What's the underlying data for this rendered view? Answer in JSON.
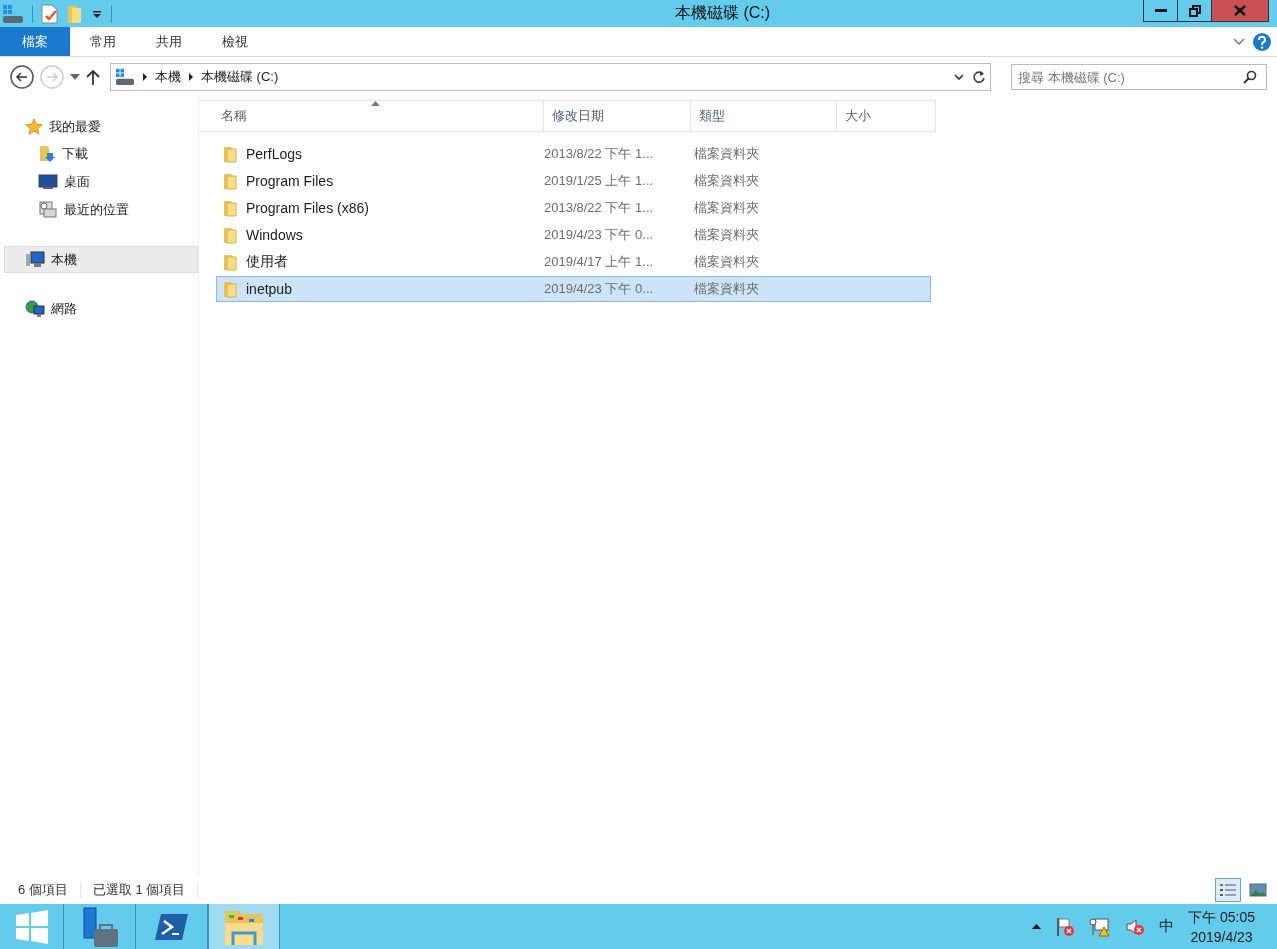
{
  "window": {
    "title": "本機磁碟 (C:)"
  },
  "ribbon": {
    "tabs": [
      {
        "label": "檔案",
        "kind": "file",
        "selected": false
      },
      {
        "label": "常用",
        "kind": "tab",
        "selected": false
      },
      {
        "label": "共用",
        "kind": "tab",
        "selected": false
      },
      {
        "label": "檢視",
        "kind": "tab",
        "selected": false
      }
    ]
  },
  "address": {
    "crumbs": [
      "本機",
      "本機磁碟 (C:)"
    ]
  },
  "search": {
    "placeholder": "搜尋 本機磁碟 (C:)"
  },
  "sidebar": {
    "items": [
      {
        "label": "我的最愛",
        "kind": "star",
        "selected": false,
        "children": [
          {
            "label": "下載",
            "kind": "download",
            "selected": false
          },
          {
            "label": "桌面",
            "kind": "desktop",
            "selected": false
          },
          {
            "label": "最近的位置",
            "kind": "recent",
            "selected": false
          }
        ]
      },
      {
        "label": "本機",
        "kind": "computer",
        "selected": true
      },
      {
        "label": "網路",
        "kind": "network",
        "selected": false
      }
    ]
  },
  "table": {
    "columns": [
      {
        "label": "名稱",
        "sorted": true
      },
      {
        "label": "修改日期",
        "sorted": false
      },
      {
        "label": "類型",
        "sorted": false
      },
      {
        "label": "大小",
        "sorted": false
      }
    ],
    "rows": [
      {
        "name": "PerfLogs",
        "modified": "2013/8/22 下午 1...",
        "type": "檔案資料夾",
        "selected": false
      },
      {
        "name": "Program Files",
        "modified": "2019/1/25 上午 1...",
        "type": "檔案資料夾",
        "selected": false
      },
      {
        "name": "Program Files (x86)",
        "modified": "2013/8/22 下午 1...",
        "type": "檔案資料夾",
        "selected": false
      },
      {
        "name": "Windows",
        "modified": "2019/4/23 下午 0...",
        "type": "檔案資料夾",
        "selected": false
      },
      {
        "name": "使用者",
        "modified": "2019/4/17 上午 1...",
        "type": "檔案資料夾",
        "selected": false
      },
      {
        "name": "inetpub",
        "modified": "2019/4/23 下午 0...",
        "type": "檔案資料夾",
        "selected": true
      }
    ]
  },
  "status_bar": {
    "item_count": "6 個項目",
    "selection": "已選取 1 個項目",
    "view_buttons": [
      {
        "kind": "details",
        "selected": true
      },
      {
        "kind": "large-icons",
        "selected": false
      }
    ]
  },
  "taskbar": {
    "apps": [
      {
        "kind": "start",
        "selected": false
      },
      {
        "kind": "server-manager",
        "selected": false
      },
      {
        "kind": "powershell",
        "selected": false
      },
      {
        "kind": "explorer",
        "selected": true
      }
    ],
    "ime": "中",
    "time": "下午 05:05",
    "date": "2019/4/23"
  }
}
